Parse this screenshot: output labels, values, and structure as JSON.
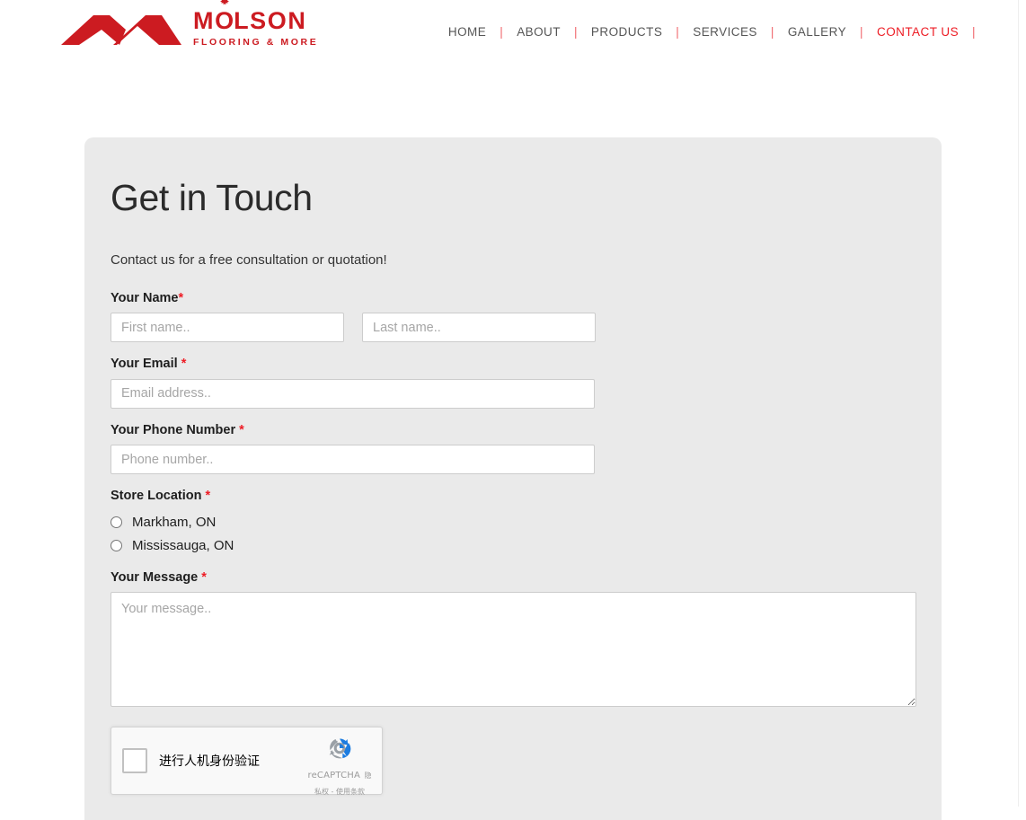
{
  "brand": {
    "name_pre": "M",
    "name_o": "O",
    "name_post": "LSON",
    "tagline": "FLOORING & MORE",
    "mark_icon": "double-chevron-roof-logo",
    "leaf_icon": "maple-leaf-icon",
    "color": "#cc1b21"
  },
  "nav": {
    "separator": "|",
    "active_color": "#ed1c24",
    "items": [
      {
        "label": "HOME",
        "active": false
      },
      {
        "label": "ABOUT",
        "active": false
      },
      {
        "label": "PRODUCTS",
        "active": false
      },
      {
        "label": "SERVICES",
        "active": false
      },
      {
        "label": "GALLERY",
        "active": false
      },
      {
        "label": "CONTACT US",
        "active": true
      }
    ]
  },
  "main": {
    "title": "Get in Touch",
    "lede": "Contact us for a free consultation or quotation!",
    "required_marker": "*",
    "fields": {
      "name": {
        "label": "Your Name",
        "first_placeholder": "First name..",
        "first_value": "",
        "last_placeholder": "Last name..",
        "last_value": ""
      },
      "email": {
        "label": "Your Email",
        "placeholder": "Email address..",
        "value": ""
      },
      "phone": {
        "label": "Your Phone Number",
        "placeholder": "Phone number..",
        "value": ""
      },
      "store_location": {
        "label": "Store Location",
        "options": [
          {
            "label": "Markham, ON",
            "selected": false
          },
          {
            "label": "Mississauga, ON",
            "selected": false
          }
        ]
      },
      "message": {
        "label": "Your Message",
        "placeholder": "Your message..",
        "value": ""
      }
    },
    "recaptcha": {
      "checkbox_label": "进行人机身份验证",
      "brand_name": "reCAPTCHA",
      "legal": "隐私权 - 使用条款",
      "logo_icon": "recaptcha-logo-icon",
      "checked": false
    }
  },
  "colors": {
    "card_bg": "#eaeaea",
    "page_bg": "#ffffff",
    "brand_red": "#cc1b21",
    "accent_red": "#ed1c24",
    "label_text": "#1e1e1e"
  }
}
